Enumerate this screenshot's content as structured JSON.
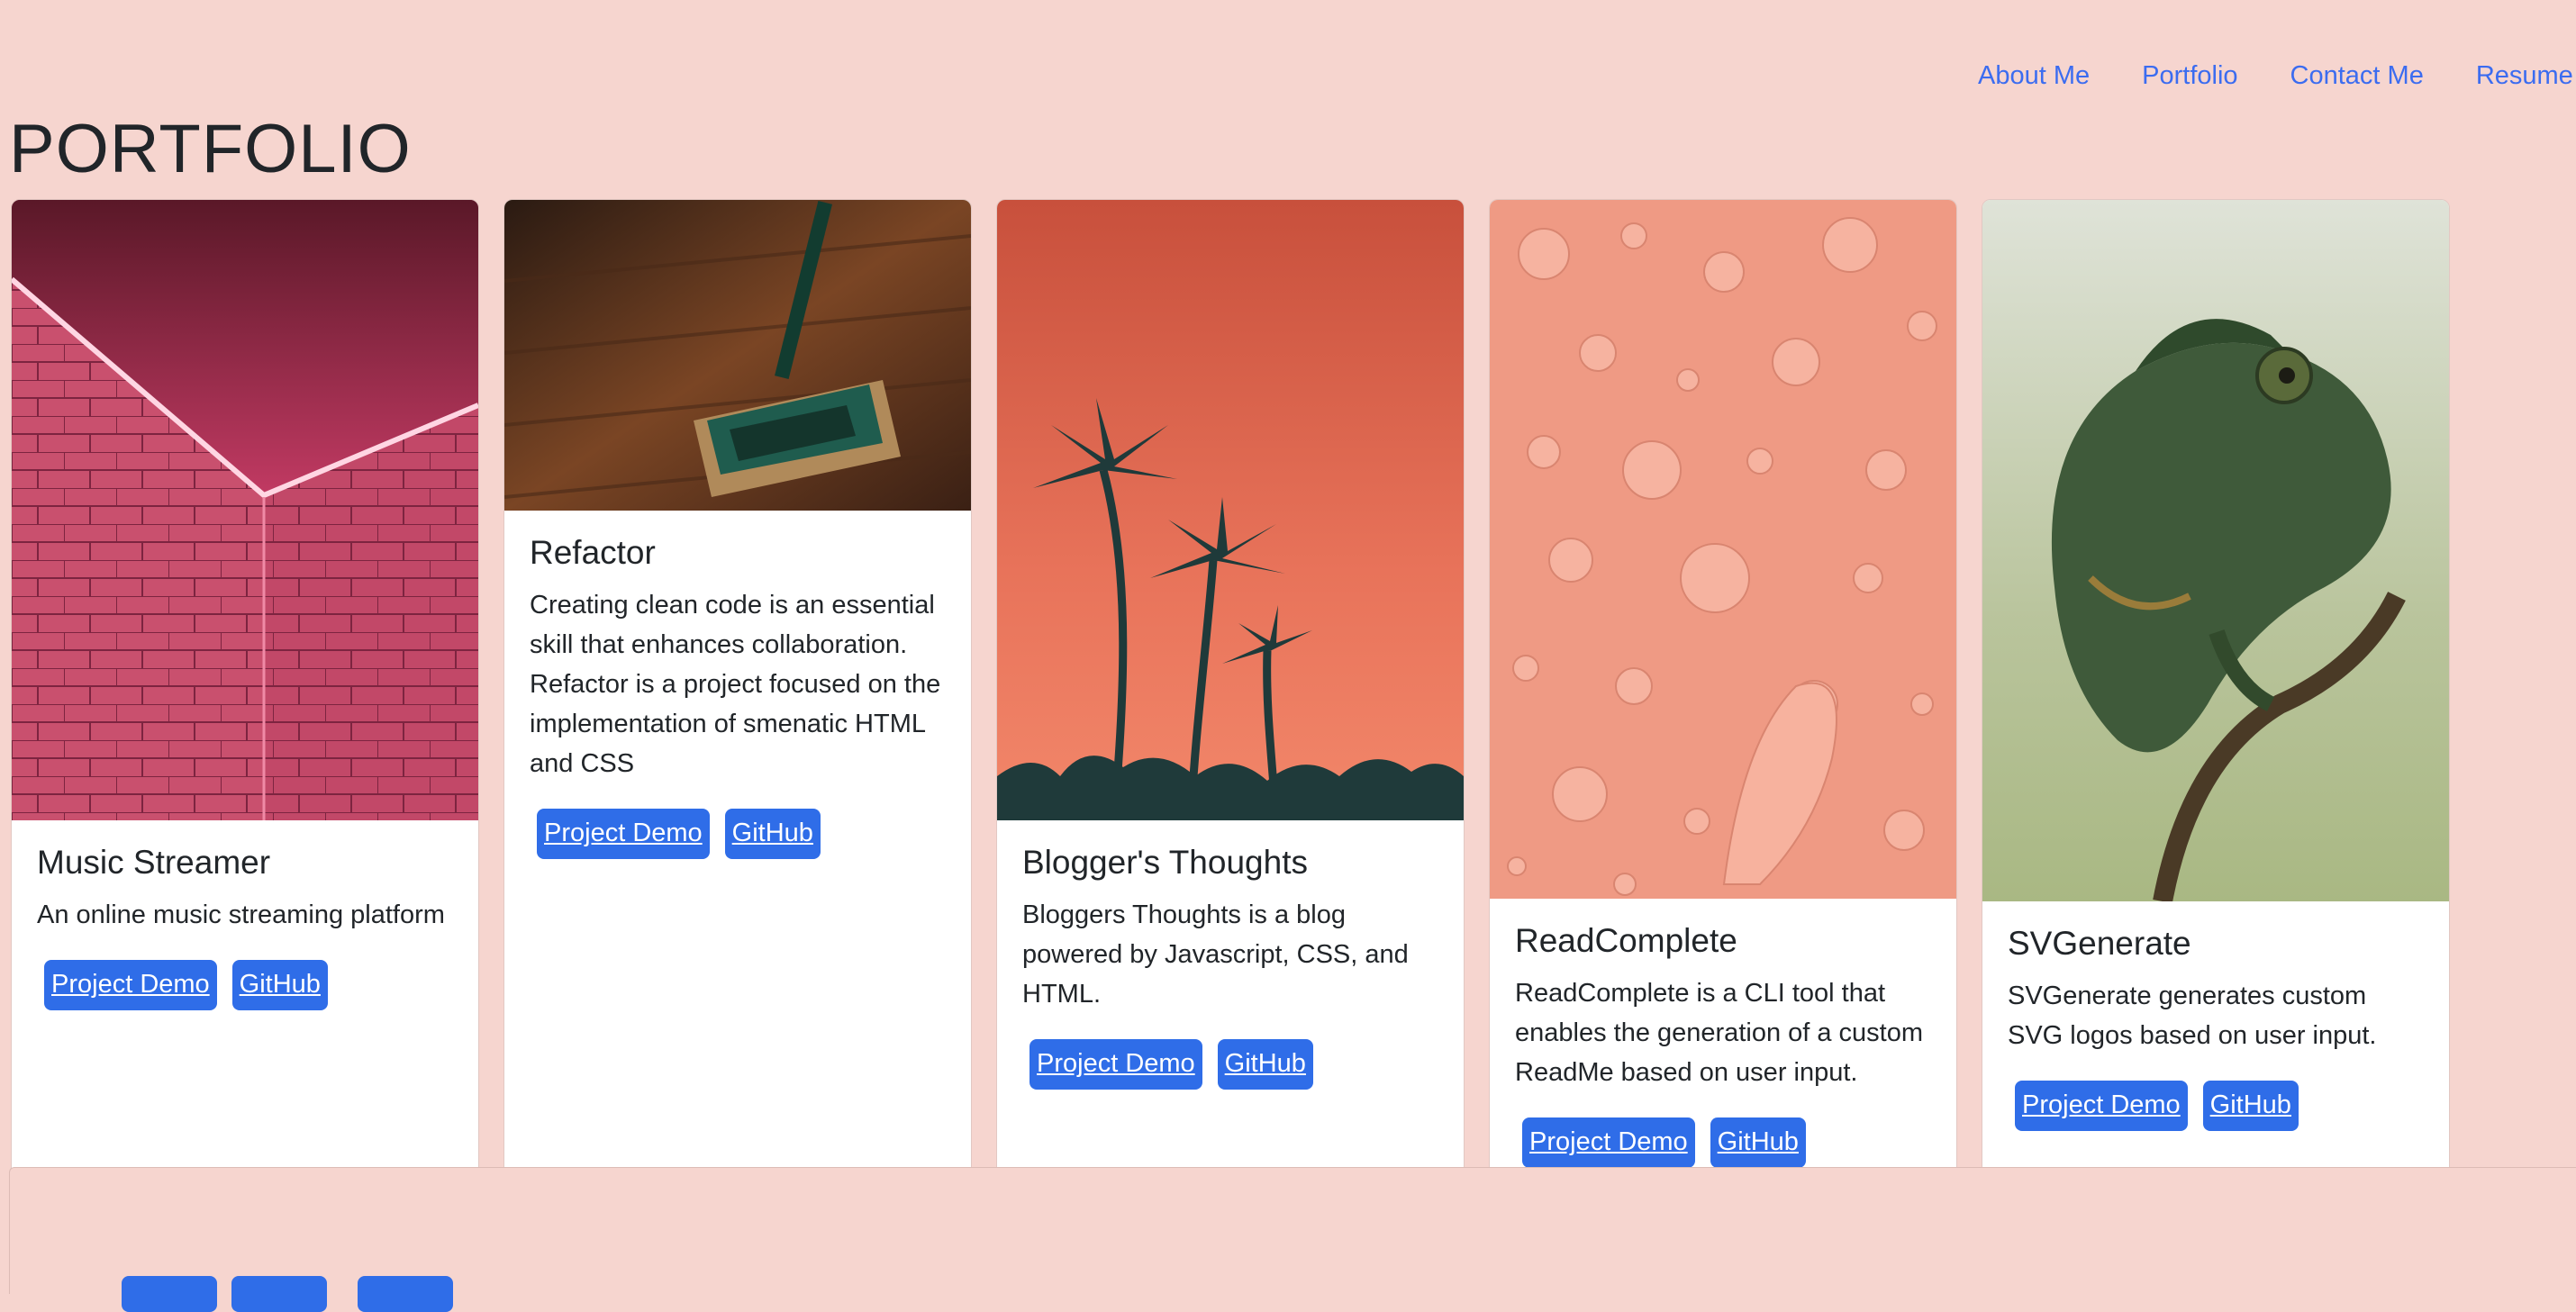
{
  "nav": {
    "items": [
      "About Me",
      "Portfolio",
      "Contact Me",
      "Resume"
    ]
  },
  "page": {
    "title": "PORTFOLIO"
  },
  "projects": [
    {
      "title": "Music Streamer",
      "description": "An online music streaming platform",
      "demo_label": "Project Demo",
      "github_label": "GitHub",
      "image": "pink-neon-brick-corner"
    },
    {
      "title": "Refactor",
      "description": "Creating clean code is an essential skill that enhances collaboration. Refactor is a project focused on the implementation of smenatic HTML and CSS",
      "demo_label": "Project Demo",
      "github_label": "GitHub",
      "image": "mop-on-wood-floor"
    },
    {
      "title": "Blogger's Thoughts",
      "description": "Bloggers Thoughts is a blog powered by Javascript, CSS, and HTML.",
      "demo_label": "Project Demo",
      "github_label": "GitHub",
      "image": "palm-trees-orange-sky"
    },
    {
      "title": "ReadComplete",
      "description": "ReadComplete is a CLI tool that enables the generation of a custom ReadMe based on user input.",
      "demo_label": "Project Demo",
      "github_label": "GitHub",
      "image": "water-droplets-peach"
    },
    {
      "title": "SVGenerate",
      "description": "SVGenerate generates custom SVG logos based on user input.",
      "demo_label": "Project Demo",
      "github_label": "GitHub",
      "image": "chameleon-on-branch"
    }
  ],
  "colors": {
    "background": "#f6d5cf",
    "link": "#3b6cf0",
    "button": "#2f6de8",
    "card": "#ffffff"
  }
}
